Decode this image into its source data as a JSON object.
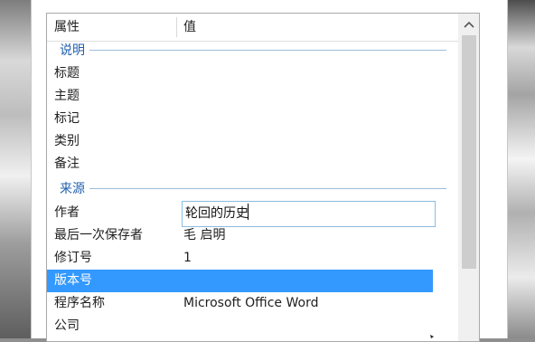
{
  "window": {
    "header": {
      "property_label": "属性",
      "value_label": "值"
    },
    "groups": [
      {
        "title": "说明",
        "items": [
          {
            "label": "标题",
            "value": ""
          },
          {
            "label": "主题",
            "value": ""
          },
          {
            "label": "标记",
            "value": ""
          },
          {
            "label": "类别",
            "value": ""
          },
          {
            "label": "备注",
            "value": ""
          }
        ]
      },
      {
        "title": "来源",
        "items": [
          {
            "label": "作者",
            "value": "轮回的历史"
          },
          {
            "label": "最后一次保存者",
            "value": "毛 启明"
          },
          {
            "label": "修订号",
            "value": "1"
          },
          {
            "label": "版本号",
            "value": ""
          },
          {
            "label": "程序名称",
            "value": "Microsoft Office Word"
          },
          {
            "label": "公司",
            "value": ""
          }
        ]
      }
    ],
    "selected_row": "版本号",
    "editing_field": "作者",
    "colors": {
      "selection": "#3399ff",
      "group_title": "#1f5fae",
      "group_line": "#9fbdda",
      "editor_border": "#8cbcdf"
    },
    "icons": {
      "scroll_up": "chevron-up-icon"
    }
  }
}
